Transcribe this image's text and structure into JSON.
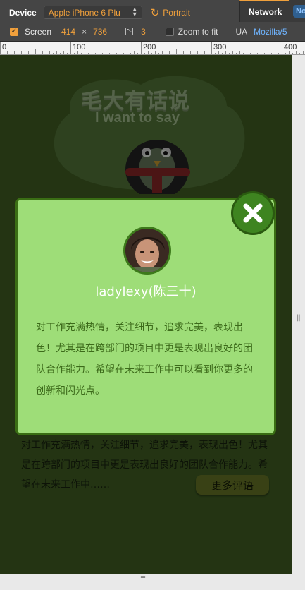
{
  "devtools": {
    "device_label": "Device",
    "device_value": "Apple iPhone 6 Plu",
    "orientation_label": "Portrait",
    "screen_label": "Screen",
    "screen_width": "414",
    "times": "×",
    "screen_height": "736",
    "dpr_value": "3",
    "zoom_label": "Zoom to fit",
    "network_tab": "Network",
    "network_value": "No",
    "ua_label": "UA",
    "ua_value": "Mozilla/5",
    "accent_color": "#f0a03c"
  },
  "ruler": {
    "labels": [
      "0",
      "100",
      "200",
      "300",
      "400"
    ]
  },
  "page": {
    "brand_cn": "毛大有话说",
    "brand_en": "I want to say",
    "bg_comment": "对工作充满热情，关注细节，追求完美，表现出色！尤其是在跨部门的项目中更是表现出良好的团队合作能力。希望在未来工作中……",
    "more_button": "更多评语"
  },
  "modal": {
    "user_name": "ladylexy(陈三十)",
    "comment": "对工作充满热情，关注细节，追求完美，表现出色！尤其是在跨部门的项目中更是表现出良好的团队合作能力。希望在未来工作中可以看到你更多的创新和闪光点。",
    "close_icon": "close-x-icon",
    "theme_color": "#9edd78",
    "border_color": "#3a6e14"
  }
}
